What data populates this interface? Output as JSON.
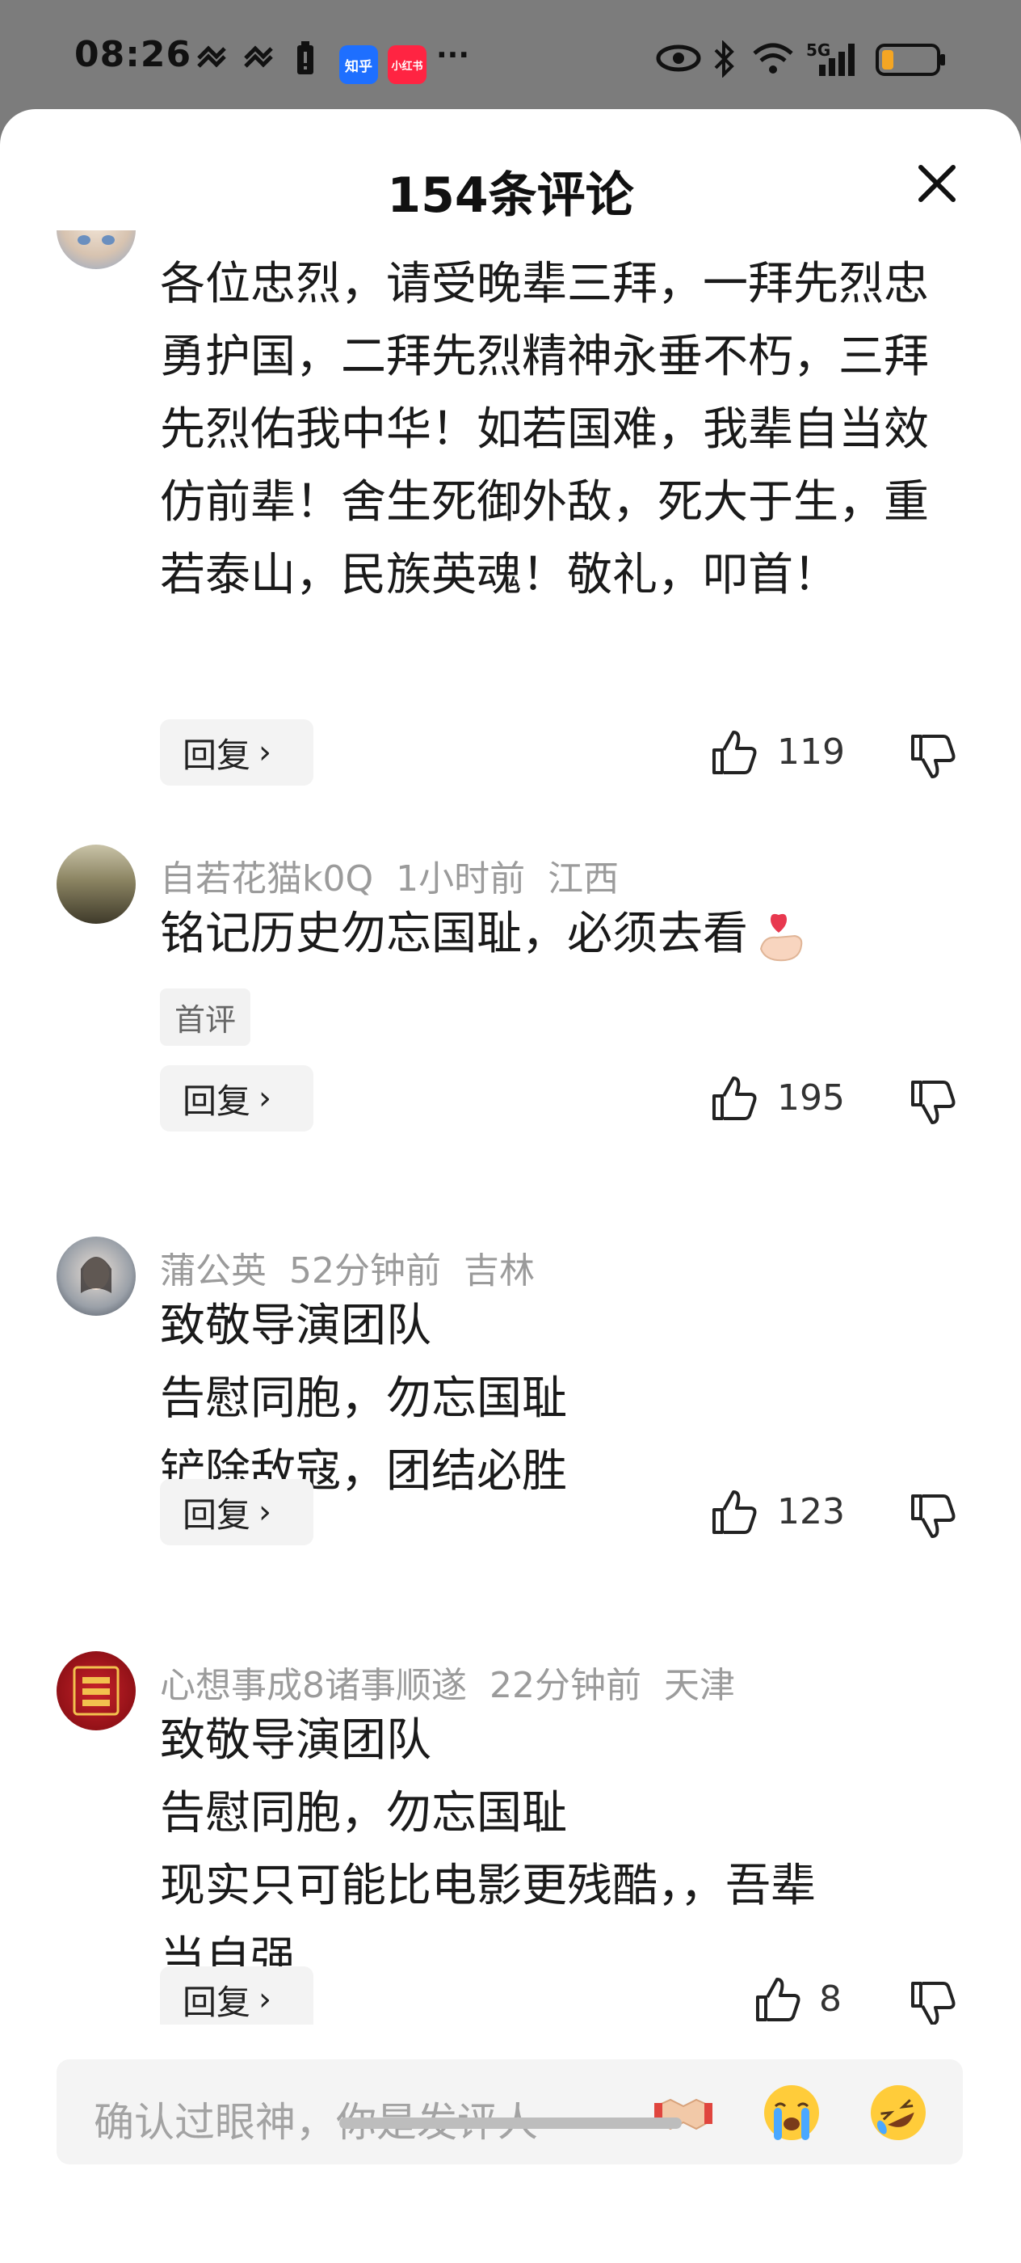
{
  "status_bar": {
    "time": "08:26",
    "apps": [
      {
        "label": "知乎",
        "color": "#1e6fff",
        "icon": "zhihu-app-icon"
      },
      {
        "label": "小红书",
        "color": "#ff2442",
        "icon": "xiaohongshu-app-icon"
      }
    ],
    "more": "···",
    "network": "5G"
  },
  "sheet": {
    "title": "154条评论"
  },
  "comments": [
    {
      "meta_user": "",
      "meta_time": "",
      "meta_location": "",
      "text": "各位忠烈，请受晚辈三拜，一拜先烈忠勇护国，二拜先烈精神永垂不朽，三拜先烈佑我中华！如若国难，我辈自当效仿前辈！舍生死御外敌，死大于生，重若泰山，民族英魂！敬礼，叩首！",
      "reply_label": "回复",
      "likes": "119"
    },
    {
      "meta_user": "自若花猫k0Q",
      "meta_time": "1小时前",
      "meta_location": "江西",
      "text": "铭记历史勿忘国耻，必须去看",
      "emoji": "finger-heart-emoji",
      "tag": "首评",
      "reply_label": "回复",
      "likes": "195"
    },
    {
      "meta_user": "蒲公英",
      "meta_time": "52分钟前",
      "meta_location": "吉林",
      "lines": [
        "致敬导演团队",
        "告慰同胞，勿忘国耻",
        "铲除敌寇，团结必胜"
      ],
      "reply_label": "回复",
      "likes": "123"
    },
    {
      "meta_user": "心想事成8诸事顺遂",
      "meta_time": "22分钟前",
      "meta_location": "天津",
      "lines": [
        "致敬导演团队",
        "告慰同胞，勿忘国耻",
        "现实只可能比电影更残酷，，吾辈",
        "当自强"
      ],
      "reply_label": "回复",
      "likes": "8"
    }
  ],
  "input": {
    "placeholder": "确认过眼神，你是发评人",
    "emojis": [
      "handshake-emoji",
      "loudly-crying-emoji",
      "rolling-laughing-emoji"
    ]
  },
  "colors": {
    "meta": "#9b9b9b",
    "background": "#ffffff",
    "overlay": "#7a7a7a"
  }
}
